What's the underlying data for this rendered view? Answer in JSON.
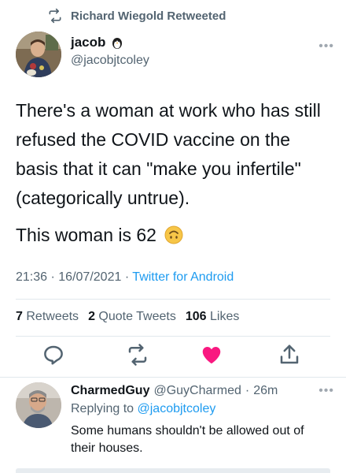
{
  "retweet_banner": {
    "text": "Richard Wiegold Retweeted",
    "icon": "retweet-icon"
  },
  "author": {
    "display_name": "jacob",
    "badge_icon": "penguin-emoji-icon",
    "handle": "@jacobjtcoley"
  },
  "more_icon": "more-icon",
  "tweet": {
    "text_line1": "There's a woman at work who has still refused the COVID vaccine on the basis that it can \"make you infertile\" (categorically untrue).",
    "text_line2": "This woman is 62",
    "emoji_icon": "upside-down-face-emoji-icon"
  },
  "meta": {
    "time": "21:36",
    "date": "16/07/2021",
    "separator": "·",
    "source": "Twitter for Android"
  },
  "stats": {
    "retweets_count": "7",
    "retweets_label": "Retweets",
    "quote_count": "2",
    "quote_label": "Quote Tweets",
    "likes_count": "106",
    "likes_label": "Likes"
  },
  "actions": [
    "reply-icon",
    "retweet-icon",
    "like-icon",
    "share-icon"
  ],
  "colors": {
    "link": "#1d9bf0",
    "like": "#f91880",
    "muted": "#536471"
  },
  "reply": {
    "display_name": "CharmedGuy",
    "handle": "@GuyCharmed",
    "separator": "·",
    "age": "26m",
    "replying_prefix": "Replying to",
    "replying_to": "@jacobjtcoley",
    "text": "Some humans shouldn't be allowed out of their houses."
  }
}
